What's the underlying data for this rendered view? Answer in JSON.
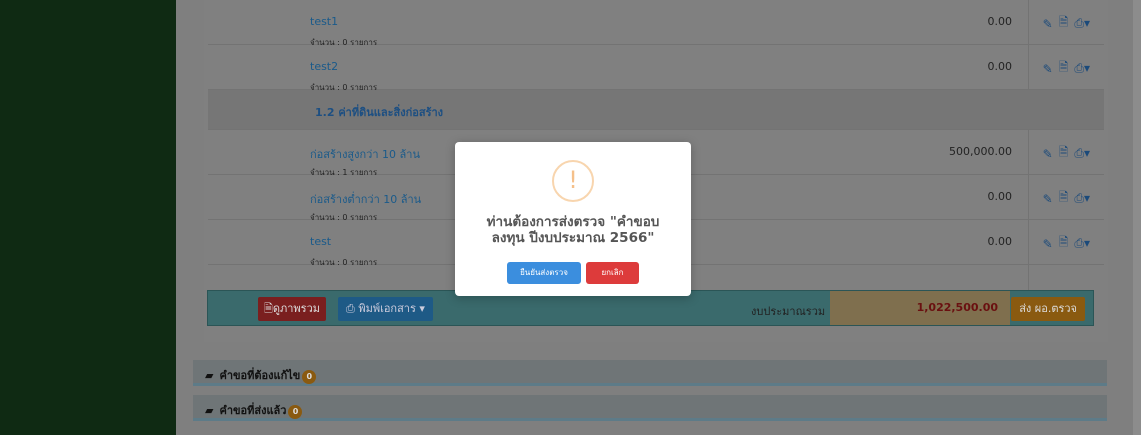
{
  "rows_top": [
    {
      "name": "test1",
      "count": "จำนวน : 0 รายการ",
      "amount": "0.00"
    },
    {
      "name": "test2",
      "count": "จำนวน : 0 รายการ",
      "amount": "0.00"
    }
  ],
  "category": {
    "name": "1.2 ค่าที่ดินและสิ่งก่อสร้าง"
  },
  "rows_bottom": [
    {
      "name": "ก่อสร้างสูงกว่า 10 ล้าน",
      "count": "จำนวน : 1 รายการ",
      "amount": "500,000.00"
    },
    {
      "name": "ก่อสร้างต่ำกว่า 10 ล้าน",
      "count": "จำนวน : 0 รายการ",
      "amount": "0.00"
    },
    {
      "name": "test",
      "count": "จำนวน : 0 รายการ",
      "amount": "0.00"
    }
  ],
  "actions": {
    "edit_icon": "edit-icon",
    "doc_icon": "document-icon",
    "print_icon": "print-icon",
    "caret": "▾"
  },
  "footer": {
    "summary_label": "ดูภาพรวม",
    "print_label": "พิมพ์เอกสาร",
    "total_label": "งบประมาณรวม",
    "total_value": "1,022,500.00",
    "send_label": "ส่ง ผอ.ตรวจ"
  },
  "accordions": [
    {
      "label": "คำขอที่ต้องแก้ไข",
      "badge": "0"
    },
    {
      "label": "คำขอที่ส่งแล้ว",
      "badge": "0"
    }
  ],
  "modal": {
    "icon": "!",
    "title_line1": "ท่านต้องการส่งตรวจ \"คำขอบ",
    "title_line2": "ลงทุน ปีงบประมาณ 2566\"",
    "confirm_label": "ยืนยันส่งตรวจ",
    "cancel_label": "ยกเลิก"
  }
}
